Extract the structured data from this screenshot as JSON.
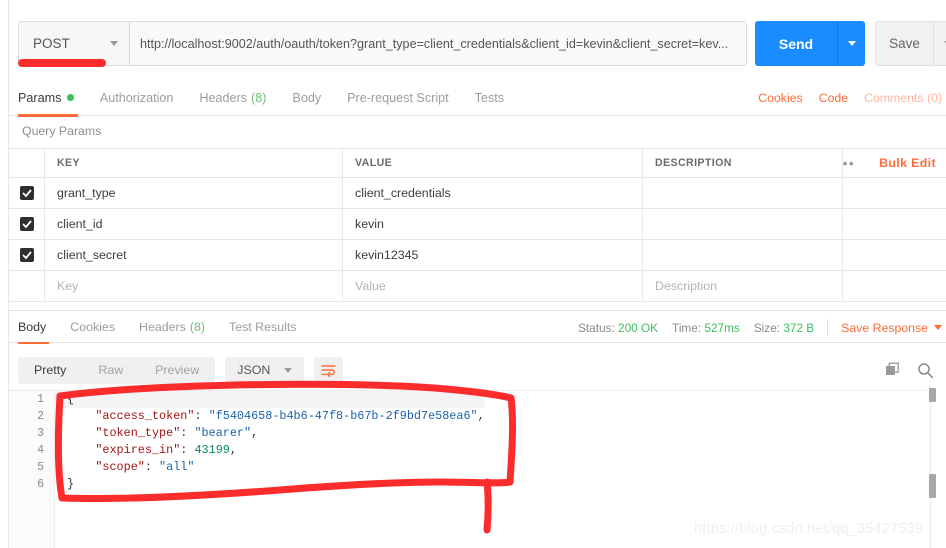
{
  "request": {
    "method": "POST",
    "url": "http://localhost:9002/auth/oauth/token?grant_type=client_credentials&client_id=kevin&client_secret=kev...",
    "send_label": "Send",
    "save_label": "Save"
  },
  "request_tabs": [
    {
      "label": "Params",
      "badge": "",
      "dot": true,
      "active": true
    },
    {
      "label": "Authorization",
      "badge": "",
      "dot": false,
      "active": false
    },
    {
      "label": "Headers",
      "badge": "(8)",
      "dot": false,
      "active": false
    },
    {
      "label": "Body",
      "badge": "",
      "dot": false,
      "active": false
    },
    {
      "label": "Pre-request Script",
      "badge": "",
      "dot": false,
      "active": false
    },
    {
      "label": "Tests",
      "badge": "",
      "dot": false,
      "active": false
    }
  ],
  "request_tabs_right": [
    {
      "label": "Cookies",
      "faded": false
    },
    {
      "label": "Code",
      "faded": false
    },
    {
      "label": "Comments (0)",
      "faded": true
    }
  ],
  "query_params": {
    "section_label": "Query Params",
    "columns": [
      "KEY",
      "VALUE",
      "DESCRIPTION"
    ],
    "bulk_edit_label": "Bulk Edit",
    "dots_label": "•••",
    "rows": [
      {
        "checked": true,
        "key": "grant_type",
        "value": "client_credentials",
        "description": ""
      },
      {
        "checked": true,
        "key": "client_id",
        "value": "kevin",
        "description": ""
      },
      {
        "checked": true,
        "key": "client_secret",
        "value": "kevin12345",
        "description": ""
      }
    ],
    "empty_row": {
      "key": "Key",
      "value": "Value",
      "description": "Description"
    }
  },
  "response_tabs": [
    {
      "label": "Body",
      "badge": "",
      "active": true
    },
    {
      "label": "Cookies",
      "badge": "",
      "active": false
    },
    {
      "label": "Headers",
      "badge": "(8)",
      "active": false
    },
    {
      "label": "Test Results",
      "badge": "",
      "active": false
    }
  ],
  "response_meta": {
    "status_label": "Status:",
    "status_value": "200 OK",
    "time_label": "Time:",
    "time_value": "527ms",
    "size_label": "Size:",
    "size_value": "372 B",
    "save_response_label": "Save Response"
  },
  "viewer": {
    "modes": [
      "Pretty",
      "Raw",
      "Preview"
    ],
    "active_mode": "Pretty",
    "format": "JSON",
    "wrap_icon": "wrap-lines-icon",
    "copy_icon": "copy-icon",
    "search_icon": "search-icon"
  },
  "response_body": {
    "line_numbers": [
      "1",
      "2",
      "3",
      "4",
      "5",
      "6"
    ],
    "json": {
      "access_token": "f5404658-b4b6-47f8-b67b-2f9bd7e58ea6",
      "token_type": "bearer",
      "expires_in": 43199,
      "scope": "all"
    },
    "lines": [
      [
        {
          "t": "{",
          "c": "p"
        }
      ],
      [
        {
          "t": "    \"access_token\"",
          "c": "k"
        },
        {
          "t": ": ",
          "c": "p"
        },
        {
          "t": "\"f5404658-b4b6-47f8-b67b-2f9bd7e58ea6\"",
          "c": "s"
        },
        {
          "t": ",",
          "c": "p"
        }
      ],
      [
        {
          "t": "    \"token_type\"",
          "c": "k"
        },
        {
          "t": ": ",
          "c": "p"
        },
        {
          "t": "\"bearer\"",
          "c": "s"
        },
        {
          "t": ",",
          "c": "p"
        }
      ],
      [
        {
          "t": "    \"expires_in\"",
          "c": "k"
        },
        {
          "t": ": ",
          "c": "p"
        },
        {
          "t": "43199",
          "c": "n"
        },
        {
          "t": ",",
          "c": "p"
        }
      ],
      [
        {
          "t": "    \"scope\"",
          "c": "k"
        },
        {
          "t": ": ",
          "c": "p"
        },
        {
          "t": "\"all\"",
          "c": "s"
        }
      ],
      [
        {
          "t": "}",
          "c": "p"
        }
      ]
    ]
  },
  "annotations": {
    "marker_color": "#fb2c2c",
    "shapes": [
      "method-underline",
      "response-body-highlight-box"
    ]
  },
  "watermark": {
    "text": "https://blog.csdn.net/qq_35427539"
  },
  "colors": {
    "accent_orange": "#ff6c37",
    "send_blue": "#1a8cff",
    "status_green": "#3fbf5f",
    "marker_red": "#fb2c2c"
  }
}
